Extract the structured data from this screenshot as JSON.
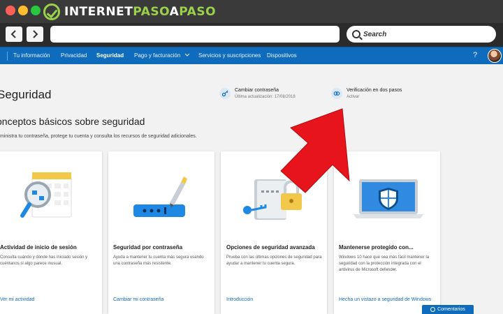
{
  "brand": {
    "part1": "INTERNET",
    "part2": "PASO",
    "part3": "A",
    "part4": "PASO"
  },
  "browser": {
    "search_placeholder": "Search",
    "back_icon": "back-arrow-icon",
    "forward_icon": "forward-arrow-icon"
  },
  "nav": {
    "items": [
      "Tu información",
      "Privacidad",
      "Seguridad",
      "Pago y facturación",
      "Servicios y suscripciones",
      "Dispositivos"
    ],
    "help": "?"
  },
  "page": {
    "title": "Seguridad",
    "quick_actions": [
      {
        "title": "Cambiar contraseña",
        "subtitle": "Última actualización: 17/08/2018",
        "icon": "key-icon"
      },
      {
        "title": "Verificación en dos pasos",
        "subtitle": "Activar",
        "icon": "shield-link-icon"
      }
    ],
    "section_title": "onceptos básicos sobre seguridad",
    "section_desc": "ministra tu contraseña, protege tu cuenta y consulta los recursos de seguridad adicionales."
  },
  "cards": [
    {
      "title": "Actividad de inicio de sesión",
      "desc": "Consulta cuándo y dónde has iniciado sesión y cuéntanos si algo parece inusual.",
      "link": "Ver mi actividad"
    },
    {
      "title": "Seguridad por contraseña",
      "desc": "Ayuda a mantener tu cuenta más segura usando una contraseña más resistente.",
      "link": "Cambiar mi contraseña"
    },
    {
      "title": "Opciones de seguridad avanzada",
      "desc": "Prueba con las últimas opciones de seguridad para ayudar a mantener tu cuenta segura.",
      "link": "Introducción"
    },
    {
      "title": "Mantenerse protegido con...",
      "desc": "Windows 10 hace que sea más fácil mantener la seguridad con la protección integrada con el antivirus de Microsoft defender.",
      "link": "Hecha un vistazo a seguridad de Windows"
    }
  ],
  "feedback": "Comentarios",
  "colors": {
    "accent": "#0f6cbd",
    "arrow": "#e8141c",
    "brand_green": "#9ad14b"
  }
}
